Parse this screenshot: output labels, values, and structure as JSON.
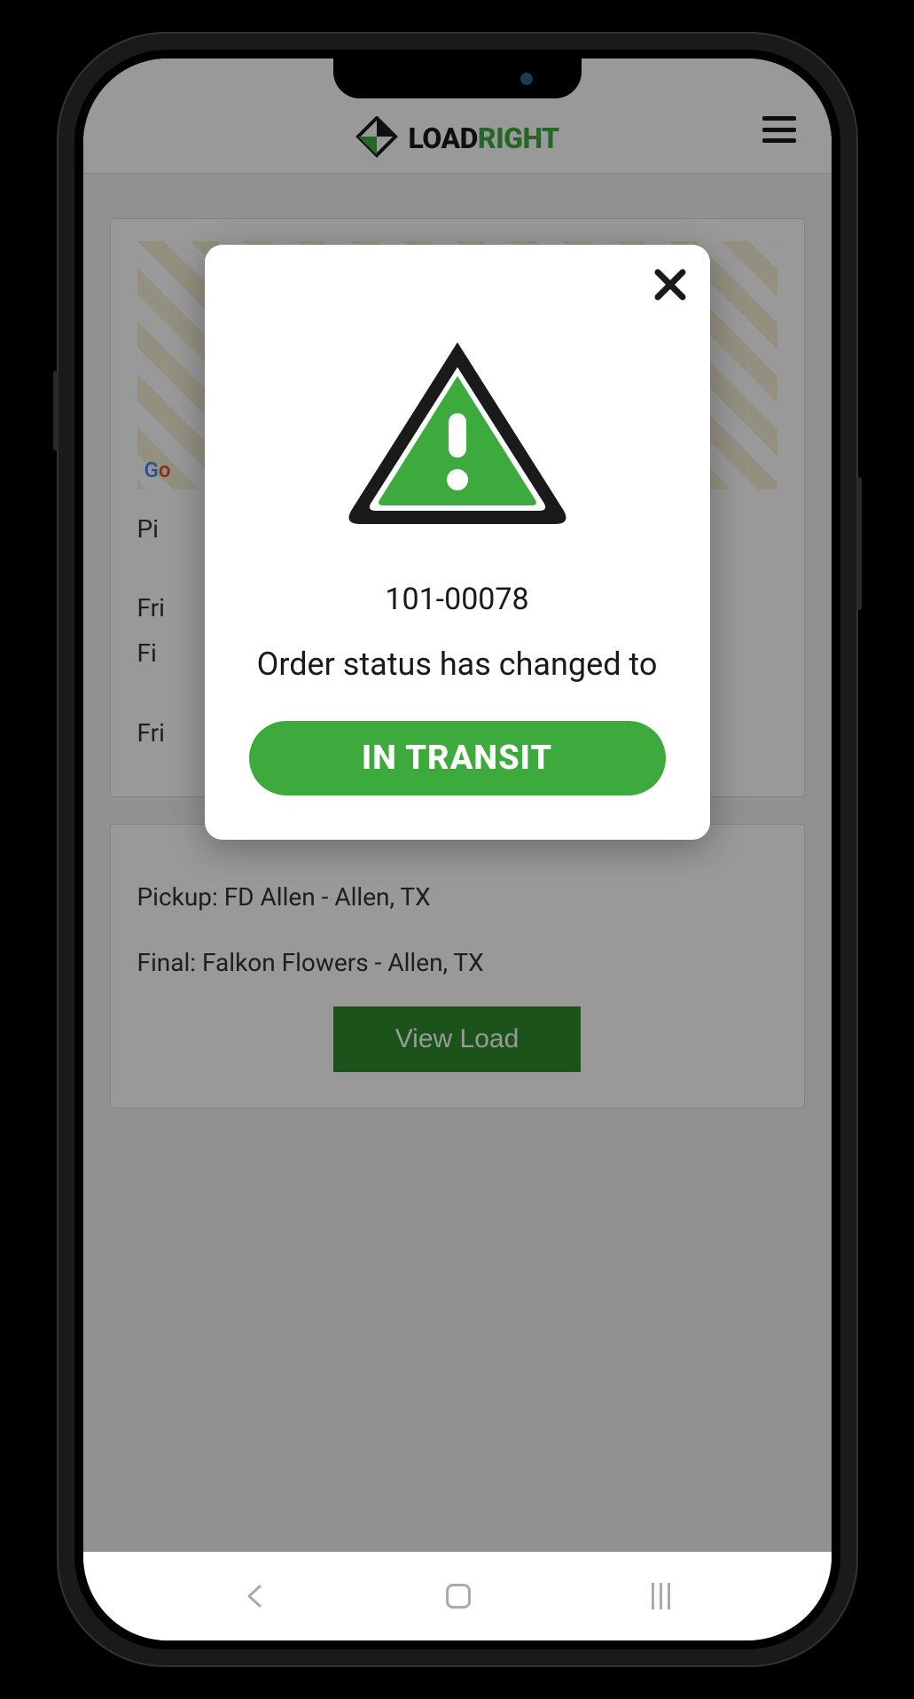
{
  "header": {
    "logo_part1": "LOAD",
    "logo_part2": "RIGHT"
  },
  "card1": {
    "pickup_prefix": "Pi",
    "date_prefix": "Fri",
    "final_prefix": "Fi",
    "google_g": "G",
    "google_o": "o"
  },
  "card2": {
    "pickup": "Pickup: FD Allen - Allen, TX",
    "final": "Final: Falkon Flowers - Allen, TX",
    "button": "View Load"
  },
  "modal": {
    "order_id": "101-00078",
    "message": "Order status has changed to",
    "status": "IN TRANSIT"
  },
  "colors": {
    "green": "#3caa3c",
    "dark_green": "#2d8a2d"
  }
}
